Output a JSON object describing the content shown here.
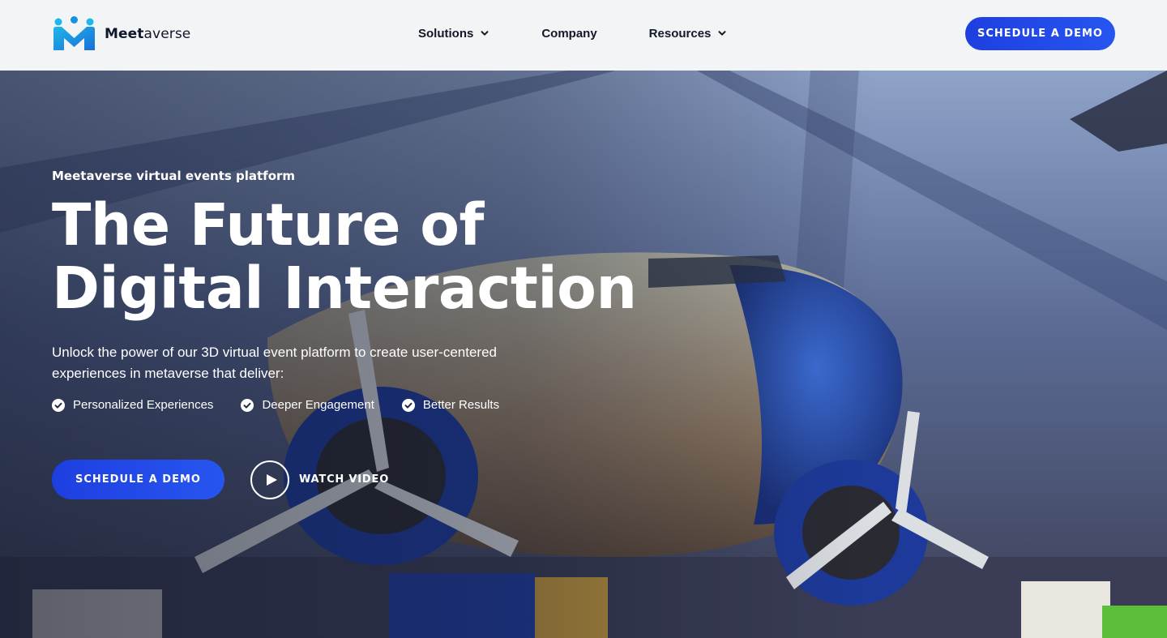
{
  "header": {
    "logo": {
      "bold": "Meet",
      "regular": "averse",
      "icon": "people-m-logo-icon"
    },
    "nav": [
      {
        "label": "Solutions",
        "has_dropdown": true
      },
      {
        "label": "Company",
        "has_dropdown": false
      },
      {
        "label": "Resources",
        "has_dropdown": true
      }
    ],
    "cta_label": "SCHEDULE A DEMO"
  },
  "hero": {
    "eyebrow": "Meetaverse virtual events platform",
    "headline_line1": "The Future of",
    "headline_line2": "Digital Interaction",
    "description": "Unlock the power of our 3D virtual event platform to create user-centered experiences in metaverse that deliver:",
    "bullets": [
      "Personalized Experiences",
      "Deeper Engagement",
      "Better Results"
    ],
    "cta_label": "SCHEDULE A DEMO",
    "watch_label": "WATCH VIDEO"
  },
  "colors": {
    "accent": "#2147e6",
    "logo_blue": "#1e9be0",
    "header_bg": "#f3f4f6",
    "text_dark": "#111827"
  }
}
